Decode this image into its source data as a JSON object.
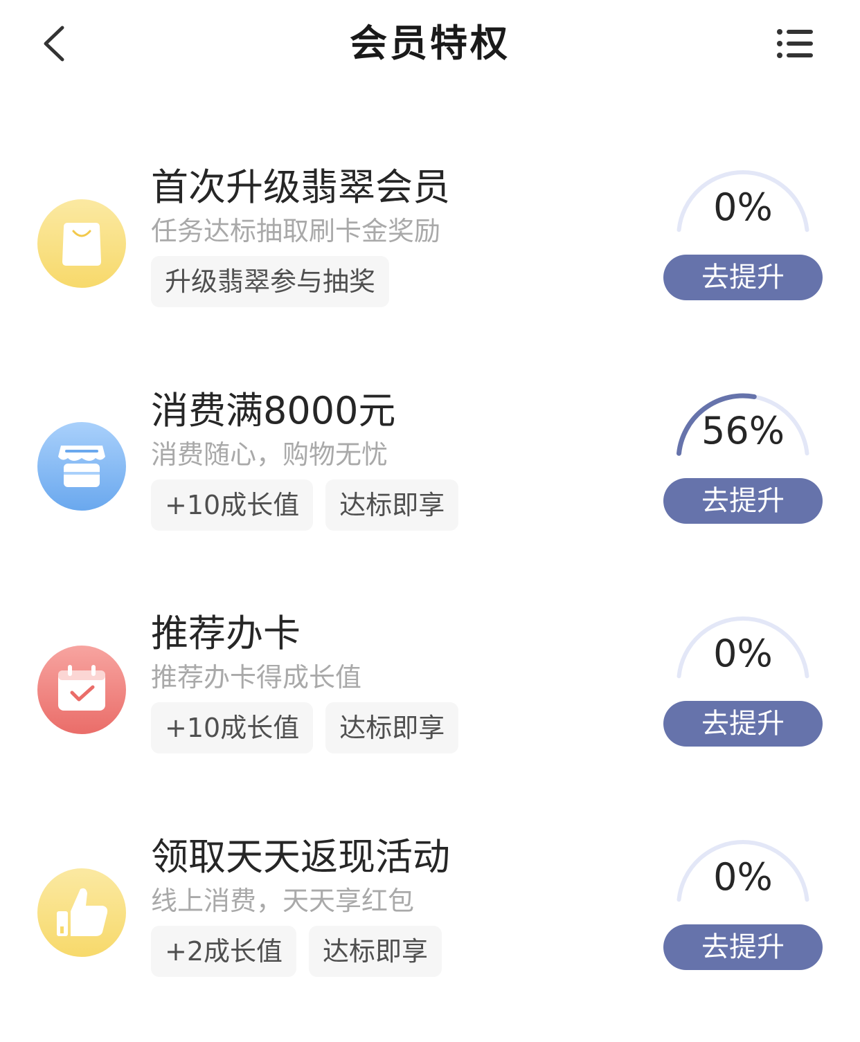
{
  "header": {
    "title": "会员特权",
    "back_icon": "back-chevron-icon",
    "menu_icon": "list-menu-icon"
  },
  "colors": {
    "accent": "#6673ab",
    "track": "#e3e7f7",
    "tag_bg": "#f6f6f6",
    "subtitle": "#a9a9a9"
  },
  "tasks": [
    {
      "icon": "shopping-bag-icon",
      "title": "首次升级翡翠会员",
      "desc": "任务达标抽取刷卡金奖励",
      "tags": [
        "升级翡翠参与抽奖"
      ],
      "progress": 0,
      "progress_label": "0%",
      "button": "去提升"
    },
    {
      "icon": "store-icon",
      "title": "消费满8000元",
      "desc": "消费随心，购物无忧",
      "tags": [
        "+10成长值",
        "达标即享"
      ],
      "progress": 0.56,
      "progress_label": "56%",
      "button": "去提升"
    },
    {
      "icon": "calendar-check-icon",
      "title": "推荐办卡",
      "desc": "推荐办卡得成长值",
      "tags": [
        "+10成长值",
        "达标即享"
      ],
      "progress": 0,
      "progress_label": "0%",
      "button": "去提升"
    },
    {
      "icon": "thumbs-up-icon",
      "title": "领取天天返现活动",
      "desc": "线上消费，天天享红包",
      "tags": [
        "+2成长值",
        "达标即享"
      ],
      "progress": 0,
      "progress_label": "0%",
      "button": "去提升"
    }
  ]
}
